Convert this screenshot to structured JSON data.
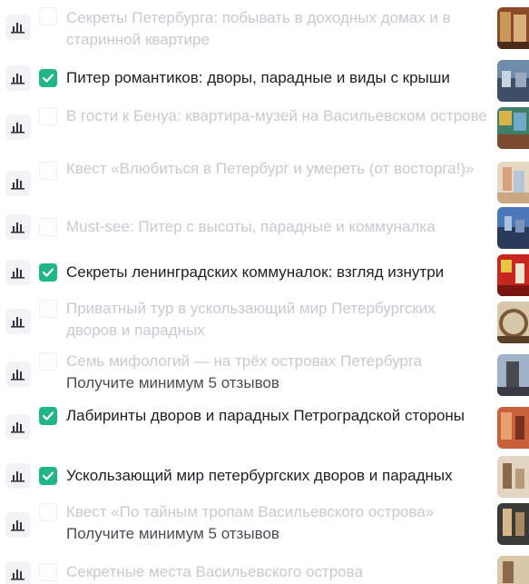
{
  "tours": [
    {
      "title": "Секреты Петербурга: побывать в доходных домах и в старинной квартире",
      "selected": false,
      "note": ""
    },
    {
      "title": "Питер романтиков: дворы, парадные и виды с крыши",
      "selected": true,
      "note": ""
    },
    {
      "title": "В гости к Бенуа: квартира-музей на Васильевском острове",
      "selected": false,
      "note": ""
    },
    {
      "title": "Квест «Влюбиться в Петербург и умереть (от восторга!)»",
      "selected": false,
      "note": ""
    },
    {
      "title": "Must-see: Питер с высоты, парадные и коммуналка",
      "selected": false,
      "note": ""
    },
    {
      "title": "Секреты ленинградских коммуналок: взгляд изнутри",
      "selected": true,
      "note": ""
    },
    {
      "title": "Приватный тур в ускользающий мир Петербургских дворов и парадных",
      "selected": false,
      "note": ""
    },
    {
      "title": "Семь мифологий — на трёх островах Петербурга",
      "selected": false,
      "note": "Получите минимум 5 отзывов"
    },
    {
      "title": "Лабиринты дворов и парадных Петроградской стороны",
      "selected": true,
      "note": ""
    },
    {
      "title": "Ускользающий мир петербургских дворов и парадных",
      "selected": true,
      "note": ""
    },
    {
      "title": "Квест «По тайным тропам Васильевского острова»",
      "selected": false,
      "note": "Получите минимум 5 отзывов"
    },
    {
      "title": "Секретные места Васильевского острова",
      "selected": false,
      "note": ""
    }
  ],
  "colors": {
    "checkbox_checked": "#21b58a",
    "text_active": "#1f1f23",
    "text_inactive": "#c9c9cf",
    "note_text": "#4c4c54"
  },
  "icons": {
    "stats": "bar-chart-icon",
    "checkmark": "check-icon",
    "thumbnail": "tour-photo-thumbnail"
  }
}
